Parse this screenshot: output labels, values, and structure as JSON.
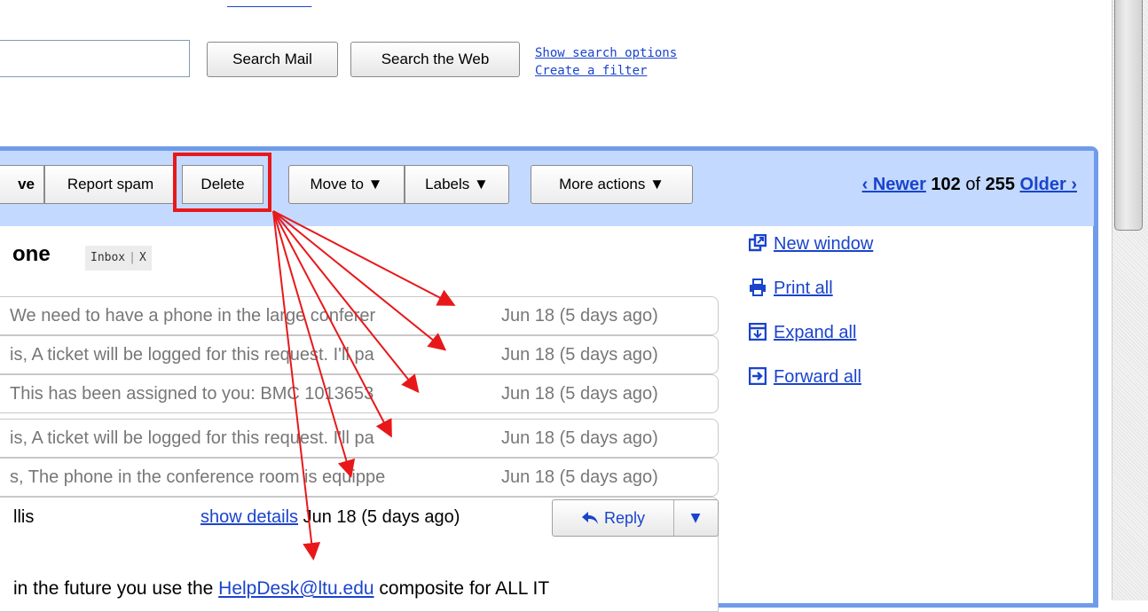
{
  "top_links": [
    "",
    "",
    "",
    "",
    ""
  ],
  "search": {
    "input_value": "",
    "search_mail_label": "Search Mail",
    "search_web_label": "Search the Web",
    "show_options_link": "Show search options",
    "create_filter_link": "Create a filter"
  },
  "toolbar": {
    "archive_partial": "ve",
    "report_spam": "Report spam",
    "delete": "Delete",
    "move_to": "Move to ▼",
    "labels": "Labels ▼",
    "more_actions": "More actions ▼"
  },
  "pager": {
    "newer": "‹ Newer",
    "current": "102",
    "of_text": "of",
    "total": "255",
    "older": "Older ›"
  },
  "conversation": {
    "subject_partial": "one",
    "label_inbox": "Inbox",
    "label_remove": "X",
    "threads": [
      {
        "snippet": "We need to have a phone in the large conferer",
        "date": "Jun 18 (5 days ago)"
      },
      {
        "snippet": "is, A ticket will be logged for this request. I'll pa",
        "date": "Jun 18 (5 days ago)"
      },
      {
        "snippet": "This has been assigned to you: BMC 1013653",
        "date": "Jun 18 (5 days ago)"
      },
      {
        "snippet": "is, A ticket will be logged for this request. I'll pa",
        "date": "Jun 18 (5 days ago)"
      },
      {
        "snippet": "s, The phone in the conference room is equippe",
        "date": "Jun 18 (5 days ago)"
      }
    ],
    "expanded": {
      "sender_partial": "llis",
      "show_details": "show details",
      "date": "Jun 18 (5 days ago)",
      "reply_label": "Reply",
      "body_prefix": "in the future you use the ",
      "body_link": "HelpDesk@ltu.edu",
      "body_suffix": " composite for ALL IT"
    }
  },
  "side_actions": {
    "new_window": "New window",
    "print_all": "Print all",
    "expand_all": "Expand all",
    "forward_all": "Forward all"
  },
  "icons": {
    "new_window": "new-window-icon",
    "print": "printer-icon",
    "expand": "expand-icon",
    "forward": "forward-icon",
    "reply": "reply-arrow-icon"
  },
  "colors": {
    "toolbar_bg": "#c3d9ff",
    "frame_border": "#6f9bea",
    "link": "#1a44cc",
    "annotation": "#e8181a"
  }
}
